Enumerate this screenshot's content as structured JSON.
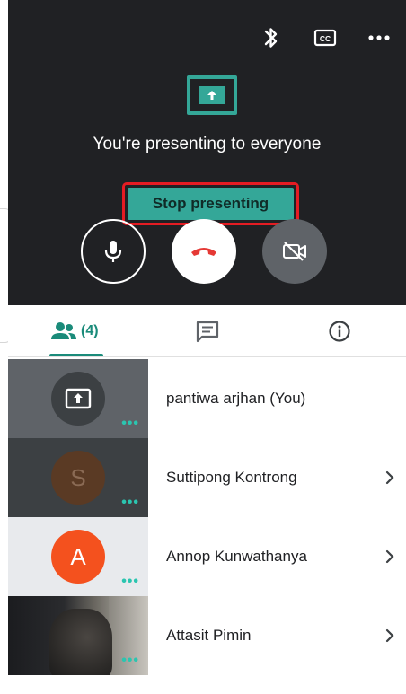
{
  "call": {
    "presenting_message": "You're presenting to everyone",
    "stop_button_label": "Stop presenting",
    "top_icons": [
      "bluetooth-icon",
      "closed-caption-icon",
      "more-options-icon"
    ],
    "cc_label": "CC"
  },
  "controls": [
    "microphone-icon",
    "end-call-icon",
    "camera-off-icon"
  ],
  "tabs": [
    {
      "name": "people",
      "icon": "people-icon",
      "count": "(4)",
      "active": true
    },
    {
      "name": "chat",
      "icon": "chat-icon"
    },
    {
      "name": "info",
      "icon": "info-icon"
    }
  ],
  "participants": [
    {
      "name": "pantiwa arjhan (You)",
      "tile": "presenting-icon"
    },
    {
      "name": "Suttipong Kontrong",
      "initial": "S"
    },
    {
      "name": "Annop Kunwathanya",
      "initial": "A"
    },
    {
      "name": "Attasit Pimin",
      "tile": "video"
    }
  ],
  "colors": {
    "accent": "#34a798",
    "highlight_border": "#e51c23",
    "dark_bg": "#202124",
    "avatar_s": "#5a3a24",
    "avatar_a": "#f4511e"
  }
}
